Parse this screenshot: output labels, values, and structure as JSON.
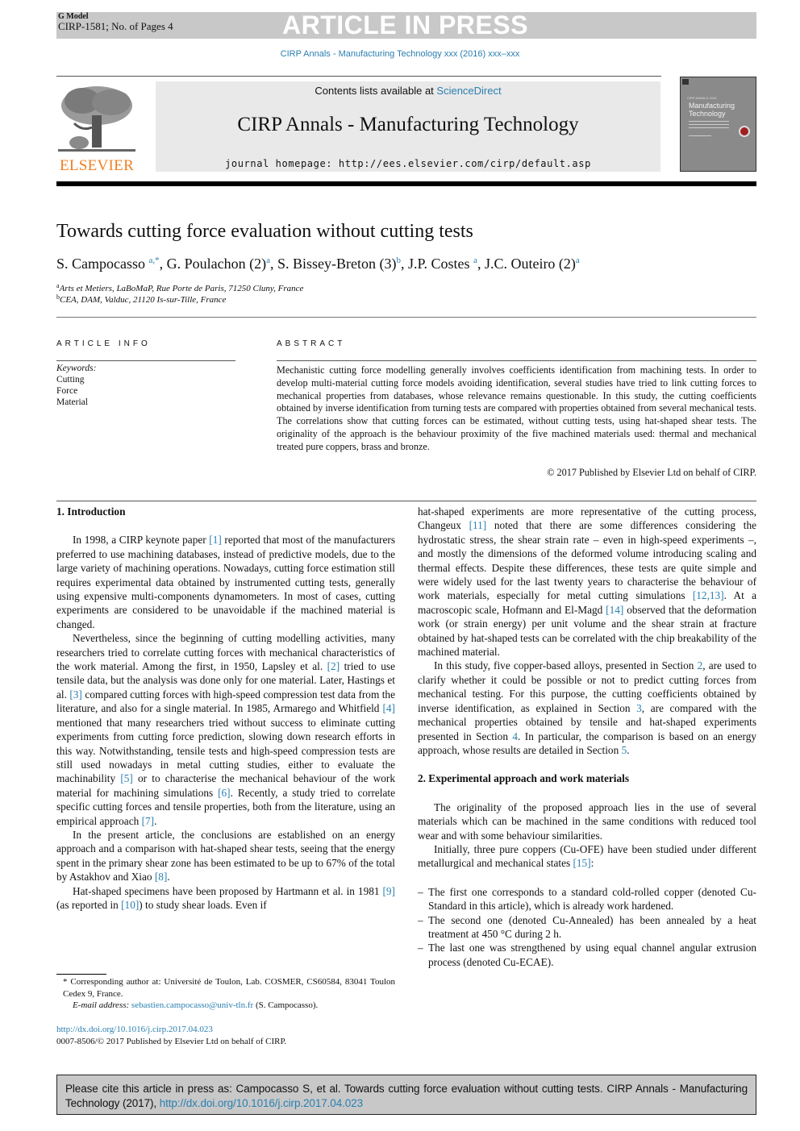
{
  "header": {
    "g_model": "G Model",
    "cirp_id": "CIRP-1581; No. of Pages 4",
    "banner": "ARTICLE IN PRESS",
    "running_head": "CIRP Annals - Manufacturing Technology xxx (2016) xxx–xxx",
    "publisher": "ELSEVIER",
    "contents_prefix": "Contents lists available at ",
    "contents_link": "ScienceDirect",
    "journal_title": "CIRP Annals - Manufacturing Technology",
    "homepage": "journal homepage: http://ees.elsevier.com/cirp/default.asp",
    "cover_small": "CIRP ANNALS 2016",
    "cover_title_1": "Manufacturing",
    "cover_title_2": "Technology"
  },
  "article": {
    "title": "Towards cutting force evaluation without cutting tests",
    "authors": [
      {
        "name": "S. Campocasso ",
        "sup": "a,*",
        "sep": ", "
      },
      {
        "name": "G. Poulachon  (2)",
        "sup": "a",
        "sep": ", "
      },
      {
        "name": "S. Bissey-Breton  (3)",
        "sup": "b",
        "sep": ", "
      },
      {
        "name": "J.P. Costes ",
        "sup": "a",
        "sep": ", "
      },
      {
        "name": "J.C. Outeiro  (2)",
        "sup": "a",
        "sep": ""
      }
    ],
    "affiliations": [
      {
        "mark": "a",
        "text": "Arts et Metiers, LaBoMaP, Rue Porte de Paris, 71250 Cluny, France"
      },
      {
        "mark": "b",
        "text": "CEA, DAM, Valduc, 21120 Is-sur-Tille, France"
      }
    ]
  },
  "article_info": {
    "label": "ARTICLE INFO",
    "keywords_head": "Keywords:",
    "keywords": [
      "Cutting",
      "Force",
      "Material"
    ]
  },
  "abstract": {
    "label": "ABSTRACT",
    "text": "Mechanistic cutting force modelling generally involves coefficients identification from machining tests. In order to develop multi-material cutting force models avoiding identification, several studies have tried to link cutting forces to mechanical properties from databases, whose relevance remains questionable. In this study, the cutting coefficients obtained by inverse identification from turning tests are compared with properties obtained from several mechanical tests. The correlations show that cutting forces can be estimated, without cutting tests, using hat-shaped shear tests. The originality of the approach is the behaviour proximity of the five machined materials used: thermal and mechanical treated pure coppers, brass and bronze.",
    "copyright": "© 2017 Published by Elsevier Ltd on behalf of CIRP."
  },
  "body": {
    "sec1_heading": "1. Introduction",
    "p1": [
      {
        "t": "In 1998, a CIRP keynote paper "
      },
      {
        "r": "[1]"
      },
      {
        "t": " reported that most of the manufacturers preferred to use machining databases, instead of predictive models, due to the large variety of machining operations. Nowadays, cutting force estimation still requires experimental data obtained by instrumented cutting tests, generally using expensive multi-components dynamometers. In most of cases, cutting experiments are considered to be unavoidable if the machined material is changed."
      }
    ],
    "p2": [
      {
        "t": "Nevertheless, since the beginning of cutting modelling activities, many researchers tried to correlate cutting forces with mechanical characteristics of the work material. Among the first, in 1950, Lapsley et al. "
      },
      {
        "r": "[2]"
      },
      {
        "t": " tried to use tensile data, but the analysis was done only for one material. Later, Hastings et al. "
      },
      {
        "r": "[3]"
      },
      {
        "t": " compared cutting forces with high-speed compression test data from the literature, and also for a single material. In 1985, Armarego and Whitfield "
      },
      {
        "r": "[4]"
      },
      {
        "t": " mentioned that many researchers tried without success to eliminate cutting experiments from cutting force prediction, slowing down research efforts in this way. Notwithstanding, tensile tests and high-speed compression tests are still used nowadays in metal cutting studies, either to evaluate the machinability "
      },
      {
        "r": "[5]"
      },
      {
        "t": " or to characterise the mechanical behaviour of the work material for machining simulations "
      },
      {
        "r": "[6]"
      },
      {
        "t": ". Recently, a study tried to correlate specific cutting forces and tensile properties, both from the literature, using an empirical approach "
      },
      {
        "r": "[7]"
      },
      {
        "t": "."
      }
    ],
    "p3": [
      {
        "t": "In the present article, the conclusions are established on an energy approach and a comparison with hat-shaped shear tests, seeing that the energy spent in the primary shear zone has been estimated to be up to 67% of the total by Astakhov and Xiao "
      },
      {
        "r": "[8]"
      },
      {
        "t": "."
      }
    ],
    "p4": [
      {
        "t": "Hat-shaped specimens have been proposed by Hartmann et al. in 1981 "
      },
      {
        "r": "[9]"
      },
      {
        "t": " (as reported in "
      },
      {
        "r": "[10]"
      },
      {
        "t": ") to study shear loads. Even if hat-shaped experiments are more representative of the cutting process, Changeux "
      },
      {
        "r": "[11]"
      },
      {
        "t": " noted that there are some differences considering the hydrostatic stress, the shear strain rate – even in high-speed experiments –, and mostly the dimensions of the deformed volume introducing scaling and thermal effects. Despite these differences, these tests are quite simple and were widely used for the last twenty years to characterise the behaviour of work materials, especially for metal cutting simulations "
      },
      {
        "r": "[12,13]"
      },
      {
        "t": ". At a macroscopic scale, Hofmann and El-Magd "
      },
      {
        "r": "[14]"
      },
      {
        "t": " observed that the deformation work (or strain energy) per unit volume and the shear strain at fracture obtained by hat-shaped tests can be correlated with the chip breakability of the machined material."
      }
    ],
    "p5": [
      {
        "t": "In this study, five copper-based alloys, presented in Section "
      },
      {
        "r": "2"
      },
      {
        "t": ", are used to clarify whether it could be possible or not to predict cutting forces from mechanical testing. For this purpose, the cutting coefficients obtained by inverse identification, as explained in Section "
      },
      {
        "r": "3"
      },
      {
        "t": ", are compared with the mechanical properties obtained by tensile and hat-shaped experiments presented in Section "
      },
      {
        "r": "4"
      },
      {
        "t": ". In particular, the comparison is based on an energy approach, whose results are detailed in Section "
      },
      {
        "r": "5"
      },
      {
        "t": "."
      }
    ],
    "sec2_heading": "2. Experimental approach and work materials",
    "p6": [
      {
        "t": "The originality of the proposed approach lies in the use of several materials which can be machined in the same conditions with reduced tool wear and with some behaviour similarities."
      }
    ],
    "p7": [
      {
        "t": "Initially, three pure coppers (Cu-OFE) have been studied under different metallurgical and mechanical states "
      },
      {
        "r": "[15]"
      },
      {
        "t": ":"
      }
    ],
    "list": [
      "The first one corresponds to a standard cold-rolled copper (denoted Cu-Standard in this article), which is already work hardened.",
      "The second one (denoted Cu-Annealed) has been annealed by a heat treatment at 450 °C during 2 h.",
      "The last one was strengthened by using equal channel angular extrusion process (denoted Cu-ECAE)."
    ]
  },
  "footnote": {
    "corresponding": "* Corresponding author at: Université de Toulon, Lab. COSMER, CS60584, 83041 Toulon Cedex 9, France.",
    "email_label": "E-mail address: ",
    "email": "sebastien.campocasso@univ-tln.fr",
    "email_suffix": " (S. Campocasso).",
    "doi": "http://dx.doi.org/10.1016/j.cirp.2017.04.023",
    "issn": "0007-8506/© 2017 Published by Elsevier Ltd on behalf of CIRP."
  },
  "cite_box": {
    "text": "Please cite this article in press as: Campocasso S, et al. Towards cutting force evaluation without cutting tests. CIRP Annals - Manufacturing Technology (2017), ",
    "link": "http://dx.doi.org/10.1016/j.cirp.2017.04.023"
  },
  "colors": {
    "link": "#2a7fb0",
    "elsevier_orange": "#f07f20",
    "banner_gray": "#c8c8c8",
    "journal_box": "#e9e9e9"
  }
}
